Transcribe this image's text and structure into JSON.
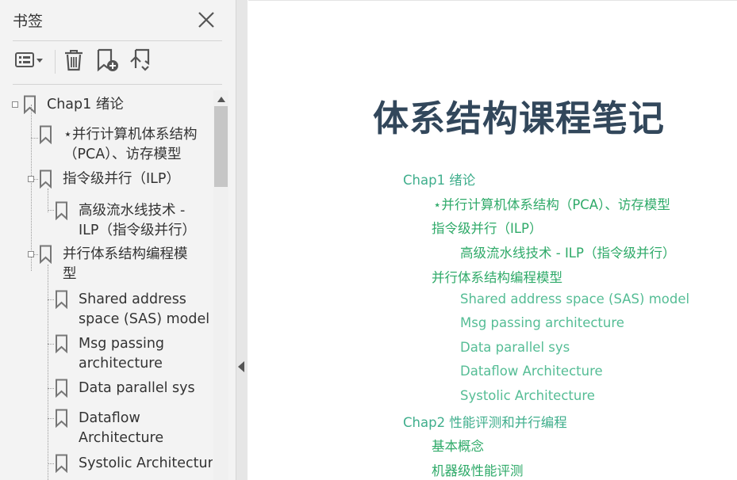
{
  "sidebar": {
    "title": "书签",
    "items": [
      {
        "label": "Chap1 绪论"
      },
      {
        "label_line1": "⋆并行计算机体系结构",
        "label_line2": "（PCA）、访存模型"
      },
      {
        "label": "指令级并行（ILP）"
      },
      {
        "label_line1": "高级流水线技术 -",
        "label_line2": "ILP（指令级并行）"
      },
      {
        "label_line1": "并行体系结构编程模",
        "label_line2": "型"
      },
      {
        "label_line1": "Shared address",
        "label_line2": "space (SAS) model"
      },
      {
        "label_line1": "Msg passing",
        "label_line2": "architecture"
      },
      {
        "label": "Data parallel sys"
      },
      {
        "label_line1": "Dataflow",
        "label_line2": "Architecture"
      },
      {
        "label": "Systolic Architecture"
      }
    ]
  },
  "document": {
    "title": "体系结构课程笔记",
    "toc": [
      {
        "text": "Chap1 绪论",
        "level": 1
      },
      {
        "text": "⋆并行计算机体系结构（PCA）、访存模型",
        "level": 2
      },
      {
        "text": "指令级并行（ILP）",
        "level": 2
      },
      {
        "text": "高级流水线技术 - ILP（指令级并行）",
        "level": 3
      },
      {
        "text": "并行体系结构编程模型",
        "level": 2
      },
      {
        "text": "Shared address space (SAS) model",
        "level": 3
      },
      {
        "text": "Msg passing architecture",
        "level": 3
      },
      {
        "text": "Data parallel sys",
        "level": 3
      },
      {
        "text": "Dataflow Architecture",
        "level": 3
      },
      {
        "text": "Systolic Architecture",
        "level": 3
      },
      {
        "text": "Chap2 性能评测和并行编程",
        "level": 1
      },
      {
        "text": "基本概念",
        "level": 2
      },
      {
        "text": "机器级性能评测",
        "level": 2
      }
    ]
  },
  "colors": {
    "toc_level1": "#3fae8c",
    "toc_level2": "#2faa69",
    "toc_level3": "#55bd95",
    "title": "#32475b"
  },
  "icons": [
    "close-icon",
    "options-menu-icon",
    "trash-icon",
    "add-bookmark-icon",
    "find-bookmark-icon",
    "bookmark-icon",
    "scroll-up-arrow-icon",
    "collapse-panel-arrow-icon"
  ]
}
